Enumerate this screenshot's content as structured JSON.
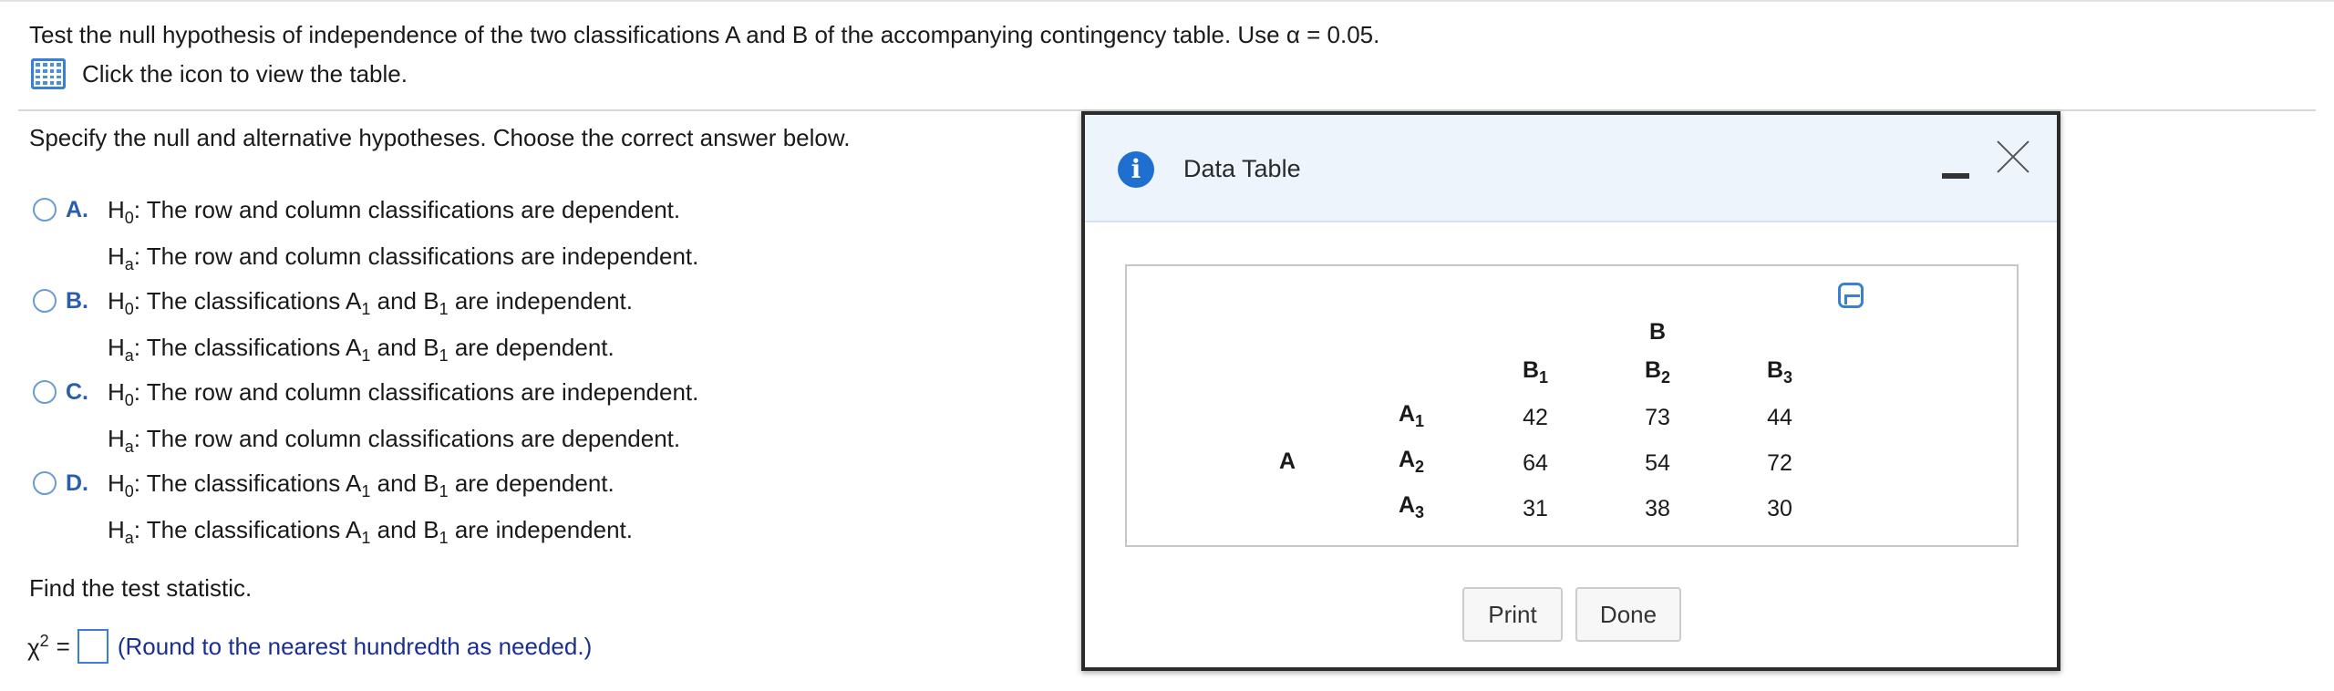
{
  "question": {
    "text": "Test the null hypothesis of independence of the two classifications A and B of the accompanying contingency table. Use α = 0.05.",
    "table_link": "Click the icon to view the table."
  },
  "instruction": "Specify the null and alternative hypotheses. Choose the correct answer below.",
  "options": [
    {
      "letter": "A.",
      "h0": "The row and column classifications are dependent.",
      "ha": "The row and column classifications are independent."
    },
    {
      "letter": "B.",
      "h0_pre": "The classifications A",
      "h0_mid": "and B",
      "h0_post": "are independent.",
      "ha_pre": "The classifications A",
      "ha_mid": "and B",
      "ha_post": "are dependent."
    },
    {
      "letter": "C.",
      "h0": "The row and column classifications are independent.",
      "ha": "The row and column classifications are dependent."
    },
    {
      "letter": "D.",
      "h0_pre": "The classifications A",
      "h0_mid": "and B",
      "h0_post": "are dependent.",
      "ha_pre": "The classifications A",
      "ha_mid": "and B",
      "ha_post": "are independent."
    }
  ],
  "labels": {
    "H": "H",
    "sub0": "0",
    "suba": "a",
    "sub1": "1",
    "colon": ":"
  },
  "find": "Find the test statistic.",
  "answer": {
    "symbol": "χ",
    "sup": "2",
    "equals": "=",
    "hint": "(Round to the nearest hundredth as needed.)"
  },
  "dialog": {
    "title": "Data Table",
    "print": "Print",
    "done": "Done",
    "table": {
      "col_group": "B",
      "row_group": "A",
      "col_headers": [
        {
          "l": "B",
          "s": "1"
        },
        {
          "l": "B",
          "s": "2"
        },
        {
          "l": "B",
          "s": "3"
        }
      ],
      "row_headers": [
        {
          "l": "A",
          "s": "1"
        },
        {
          "l": "A",
          "s": "2"
        },
        {
          "l": "A",
          "s": "3"
        }
      ],
      "values": [
        [
          "42",
          "73",
          "44"
        ],
        [
          "64",
          "54",
          "72"
        ],
        [
          "31",
          "38",
          "30"
        ]
      ]
    }
  },
  "colors": {
    "accent": "#2a5db0",
    "info": "#1f6fd1",
    "header_bg": "#eef4fc",
    "hint": "#1a2f8f"
  }
}
